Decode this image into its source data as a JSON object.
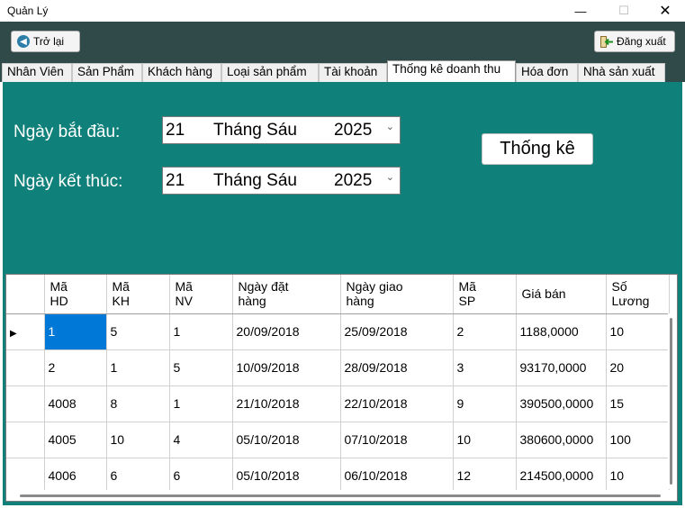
{
  "window": {
    "title": "Quản Lý",
    "minimize_symbol": "—",
    "maximize_symbol": "☐",
    "close_symbol": "✕"
  },
  "toolbar": {
    "back_label": "Trở lại",
    "logout_label": "Đăng xuất"
  },
  "tabs": [
    {
      "label": "Nhân Viên"
    },
    {
      "label": "Sản Phẩm"
    },
    {
      "label": "Khách hàng"
    },
    {
      "label": "Loại sản phẩm"
    },
    {
      "label": "Tài khoản"
    },
    {
      "label": "Thống kê doanh thu"
    },
    {
      "label": "Hóa đơn"
    },
    {
      "label": "Nhà sản xuất"
    }
  ],
  "form": {
    "start_label": "Ngày bắt đầu:",
    "end_label": "Ngày kết thúc:",
    "start_date": {
      "day": "21",
      "month": "Tháng Sáu",
      "year": "2025"
    },
    "end_date": {
      "day": "21",
      "month": "Tháng Sáu",
      "year": "2025"
    },
    "stat_button": "Thống kê"
  },
  "grid": {
    "columns": [
      {
        "l1": "Mã",
        "l2": "HD"
      },
      {
        "l1": "Mã",
        "l2": "KH"
      },
      {
        "l1": "Mã",
        "l2": "NV"
      },
      {
        "l1": "Ngày đặt",
        "l2": "hàng"
      },
      {
        "l1": "Ngày giao",
        "l2": "hàng"
      },
      {
        "l1": "Mã",
        "l2": "SP"
      },
      {
        "l1": "Giá bán",
        "l2": ""
      },
      {
        "l1": "Số",
        "l2": "Lương"
      }
    ],
    "rows": [
      [
        "1",
        "5",
        "1",
        "20/09/2018",
        "25/09/2018",
        "2",
        "1188,0000",
        "10"
      ],
      [
        "2",
        "1",
        "5",
        "10/09/2018",
        "28/09/2018",
        "3",
        "93170,0000",
        "20"
      ],
      [
        "4008",
        "8",
        "1",
        "21/10/2018",
        "22/10/2018",
        "9",
        "390500,0000",
        "15"
      ],
      [
        "4005",
        "10",
        "4",
        "05/10/2018",
        "07/10/2018",
        "10",
        "380600,0000",
        "100"
      ],
      [
        "4006",
        "6",
        "6",
        "05/10/2018",
        "06/10/2018",
        "12",
        "214500,0000",
        "10"
      ]
    ],
    "selected_row_marker": "▶"
  },
  "colors": {
    "panel_bg": "#0f807a",
    "toolbar_bg": "#2f4a49",
    "selection": "#0078d7"
  }
}
